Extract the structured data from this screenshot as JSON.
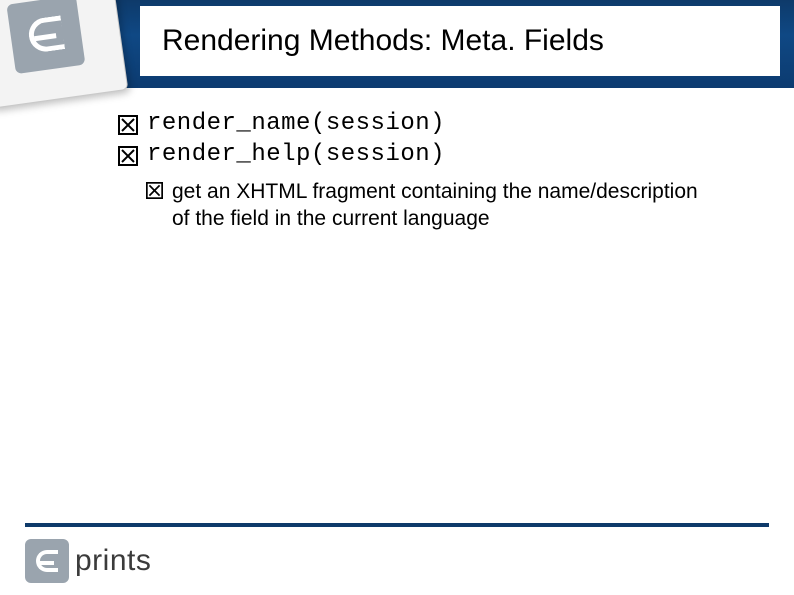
{
  "header": {
    "title": "Rendering Methods: Meta. Fields"
  },
  "bullets": [
    {
      "text": "render_name(session)",
      "style": "code"
    },
    {
      "text": "render_help(session)",
      "style": "code"
    }
  ],
  "sub_bullet": {
    "text": "get an XHTML fragment containing the name/description of the field in the current language"
  },
  "footer": {
    "logo_text": "prints"
  }
}
